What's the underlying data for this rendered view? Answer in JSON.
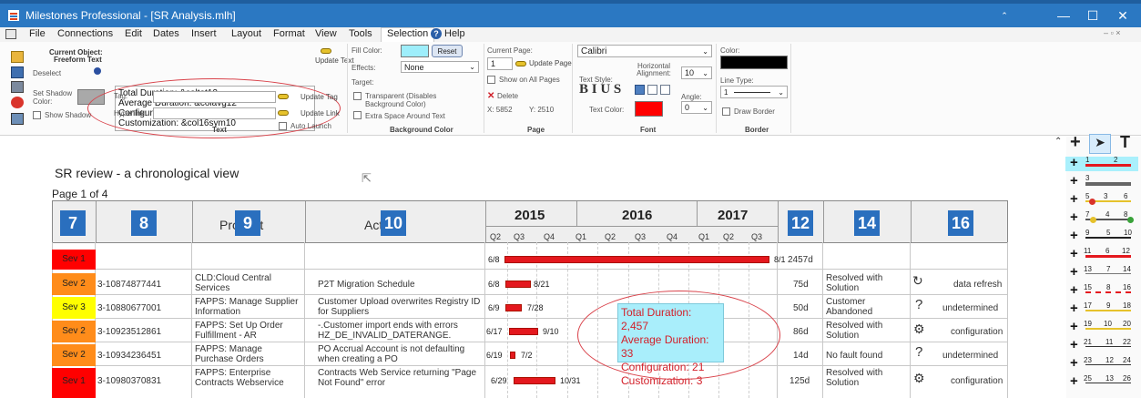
{
  "window": {
    "title": "Milestones Professional - [SR Analysis.mlh]",
    "minimize": "—",
    "maximize": "☐",
    "close": "✕"
  },
  "menu": {
    "items": [
      "File",
      "Connections",
      "Edit",
      "Dates",
      "Insert",
      "Layout",
      "Format",
      "View",
      "Tools",
      "Selection",
      "Help"
    ],
    "selected": "Selection"
  },
  "ribbon": {
    "current_object_label": "Current Object:",
    "current_object_value": "Freeform Text",
    "deselect": "Deselect",
    "set_shadow_color": "Set Shadow Color:",
    "show_shadow": "Show Shadow",
    "text_lines": [
      "Total Duration: &coltot12",
      "Average Duration: &colavg12",
      "Configuration: &col16sym11",
      "Customization: &col16sym10"
    ],
    "update_text": "Update Text",
    "tag_label": "Tag:",
    "update_tag": "Update Tag",
    "hyperlink_label": "Hyperlink:",
    "update_link": "Update Link",
    "auto_launch": "Auto Launch",
    "text_group": "Text",
    "fill_color_label": "Fill Color:",
    "reset": "Reset",
    "effects_label": "Effects:",
    "effects_value": "None",
    "target_label": "Target:",
    "transparent": "Transparent (Disables Background Color)",
    "extra_space": "Extra Space Around Text",
    "bg_group": "Background Color",
    "current_page_label": "Current Page:",
    "current_page_value": "1",
    "update_page": "Update Page",
    "show_all_pages": "Show on All Pages",
    "delete": "Delete",
    "x_coord": "X: 5852",
    "y_coord": "Y: 2510",
    "page_group": "Page",
    "font_name": "Calibri",
    "text_style_label": "Text Style:",
    "style_glyphs": "B I U S",
    "h_align_label": "Horizontal Alignment:",
    "font_size": "10",
    "angle_label": "Angle:",
    "angle_value": "0",
    "text_color_label": "Text Color:",
    "font_group": "Font",
    "color_label": "Color:",
    "line_type_label": "Line Type:",
    "line_type_value": "1",
    "draw_border": "Draw Border",
    "border_group": "Border"
  },
  "colors": {
    "fill": "#9eeefb",
    "text_color": "#ff0000",
    "border_color": "#000000",
    "header_blue": "#2a6fbe",
    "sev1": "#ff0000",
    "sev2": "#ff8c1a",
    "sev3": "#ffff00"
  },
  "chart": {
    "title": "SR review - a chronological view",
    "page": "Page 1 of 4",
    "headers": {
      "sev_num": "7",
      "sr_num": "8",
      "product_num": "9",
      "product_text": "Product",
      "activity_num": "10",
      "activity_text": "Activity",
      "duration_num": "12",
      "status_num": "14",
      "outcome_num": "16"
    },
    "years": [
      "2015",
      "2016",
      "2017"
    ],
    "quarters": [
      "Q2",
      "Q3",
      "Q4",
      "Q1",
      "Q2",
      "Q3",
      "Q4",
      "Q1",
      "Q2",
      "Q3"
    ],
    "rows": [
      {
        "sev": "Sev 1",
        "sev_color": "#ff0000",
        "sr": "",
        "product": "",
        "activity": "",
        "start": "6/8",
        "end": "8/1",
        "duration": "2457d",
        "status": "",
        "icon": "",
        "outcome": ""
      },
      {
        "sev": "Sev 2",
        "sev_color": "#ff8c1a",
        "sr": "3-10874877441",
        "product": "CLD:Cloud Central Services",
        "activity": "P2T Migration Schedule",
        "start": "6/8",
        "end": "8/21",
        "duration": "75d",
        "status": "Resolved with Solution",
        "icon": "↻",
        "outcome": "data refresh"
      },
      {
        "sev": "Sev 3",
        "sev_color": "#ffff00",
        "sr": "3-10880677001",
        "product": "FAPPS: Manage Supplier Information",
        "activity": "Customer Upload overwrites Registry ID for Suppliers",
        "start": "6/9",
        "end": "7/28",
        "duration": "50d",
        "status": "Customer Abandoned",
        "icon": "?",
        "outcome": "undetermined"
      },
      {
        "sev": "Sev 2",
        "sev_color": "#ff8c1a",
        "sr": "3-10923512861",
        "product": "FAPPS: Set Up Order Fulfillment - AR",
        "activity": "-.Customer import ends with errors HZ_DE_INVALID_DATERANGE.",
        "start": "6/17",
        "end": "9/10",
        "duration": "86d",
        "status": "Resolved with Solution",
        "icon": "⚙",
        "outcome": "configuration"
      },
      {
        "sev": "Sev 2",
        "sev_color": "#ff8c1a",
        "sr": "3-10934236451",
        "product": "FAPPS: Manage Purchase Orders",
        "activity": "PO Accrual Account is not defaulting when creating a PO",
        "start": "6/19",
        "end": "7/2",
        "duration": "14d",
        "status": "No fault found",
        "icon": "?",
        "outcome": "undetermined"
      },
      {
        "sev": "Sev 1",
        "sev_color": "#ff0000",
        "sr": "3-10980370831",
        "product": "FAPPS: Enterprise Contracts Webservice",
        "activity": "Contracts Web Service returning \"Page Not Found\" error",
        "start": "6/29",
        "end": "10/31",
        "duration": "125d",
        "status": "Resolved with Solution",
        "icon": "⚙",
        "outcome": "configuration"
      }
    ]
  },
  "tooltip": {
    "lines": [
      "Total Duration: 2,457",
      "Average Duration: 33",
      "Configuration: 21",
      "Customization: 3"
    ]
  },
  "palette": {
    "tools": [
      "+",
      "▲",
      "T"
    ],
    "rows": [
      [
        "1",
        "2"
      ],
      [
        "3",
        ""
      ],
      [
        "5",
        "3",
        "6"
      ],
      [
        "7",
        "4",
        "8"
      ],
      [
        "9",
        "5",
        "10"
      ],
      [
        "11",
        "6",
        "12"
      ],
      [
        "13",
        "7",
        "14"
      ],
      [
        "15",
        "8",
        "16"
      ],
      [
        "17",
        "9",
        "18"
      ],
      [
        "19",
        "10",
        "20"
      ],
      [
        "21",
        "11",
        "22"
      ],
      [
        "23",
        "12",
        "24"
      ],
      [
        "25",
        "13",
        "26"
      ]
    ]
  }
}
